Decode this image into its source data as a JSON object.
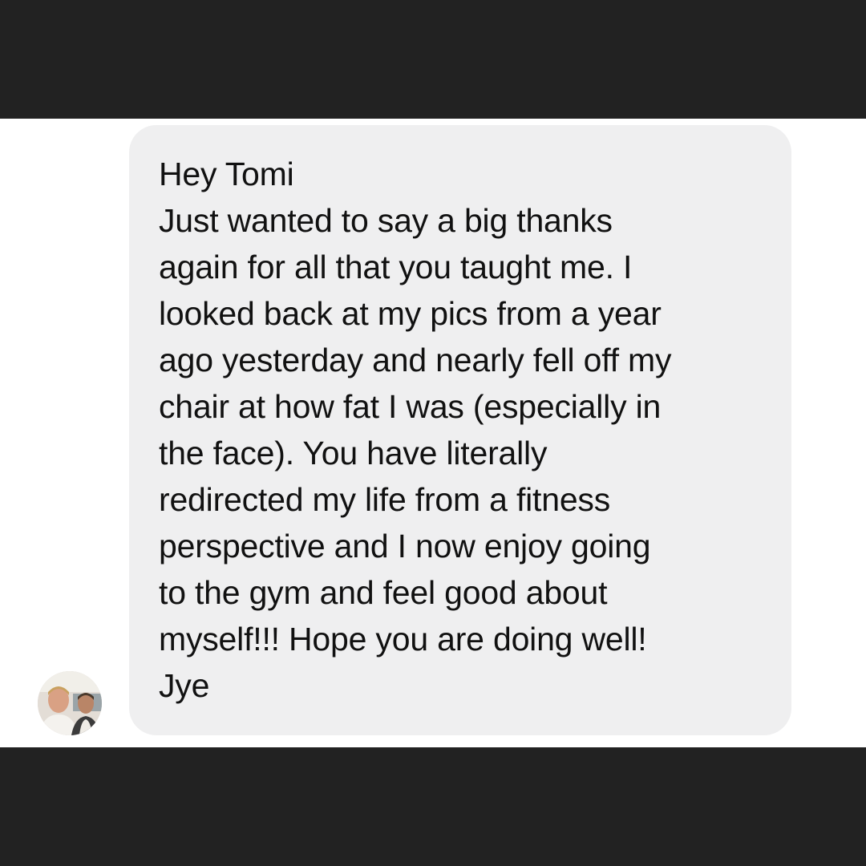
{
  "message": {
    "lines": [
      "Hey Tomi",
      "Just wanted to say a big thanks",
      "again for all that you taught me. I",
      "looked back at my pics from a year",
      "ago yesterday and nearly fell off my",
      "chair at how fat I was (especially in",
      "the face). You have literally",
      "redirected my life from a fitness",
      "perspective and I now enjoy going",
      "to the gym and feel good about",
      "myself!!! Hope you are doing well!",
      "Jye"
    ]
  },
  "colors": {
    "frame": "#222222",
    "background": "#ffffff",
    "bubble": "#efeff0",
    "text": "#111111"
  },
  "avatar": {
    "icon": "sender-avatar-photo"
  }
}
